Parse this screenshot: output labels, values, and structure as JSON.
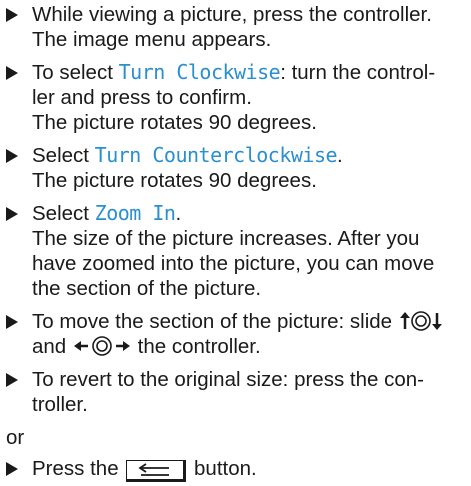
{
  "steps": [
    {
      "lines": [
        "While viewing a picture, press the controller.",
        "The image menu appears."
      ]
    },
    {
      "pre": "To select ",
      "hl": "Turn Clockwise",
      "post": ": turn the control-",
      "lines": [
        "ler and press to confirm.",
        "The picture rotates 90 degrees."
      ]
    },
    {
      "pre": "Select ",
      "hl": "Turn Counterclockwise",
      "post": ".",
      "lines": [
        "The picture rotates 90 degrees."
      ]
    },
    {
      "pre": "Select ",
      "hl": "Zoom In",
      "post": ".",
      "lines": [
        "The size of the picture increases. After you",
        "have zoomed into the picture, you can move",
        "the section of the picture."
      ]
    },
    {
      "l1": "To move the section of the picture: slide",
      "l2_and": "and",
      "l2_end": "the controller."
    },
    {
      "lines": [
        "To revert to the original size: press the con-",
        "troller."
      ]
    }
  ],
  "or_text": "or",
  "last": {
    "pre": "Press the",
    "post": "button."
  },
  "icons": {
    "bullet": "bullet-triangle-icon",
    "slide_updown": "controller-slide-up-down-icon",
    "slide_leftright": "controller-slide-left-right-icon",
    "back": "back-button-icon"
  }
}
